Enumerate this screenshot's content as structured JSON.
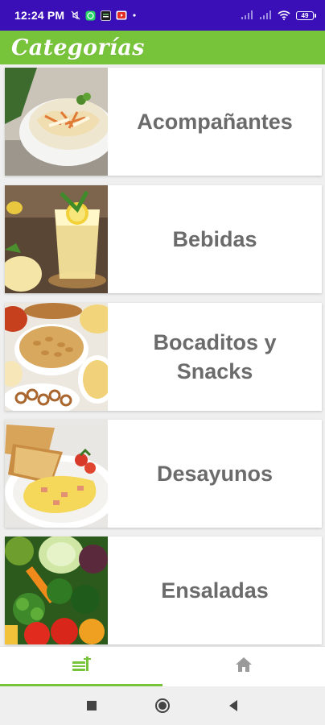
{
  "status_bar": {
    "time": "12:24 PM",
    "battery": "49",
    "icons": [
      "mute-icon",
      "whatsapp-icon",
      "notification-icon",
      "youtube-icon",
      "dot-icon",
      "signal-icon",
      "signal-icon",
      "wifi-icon",
      "battery-icon"
    ]
  },
  "app_bar": {
    "title": "Categorías"
  },
  "categories": [
    {
      "label": "Acompañantes",
      "image": "salad-bowl-photo"
    },
    {
      "label": "Bebidas",
      "image": "lemonade-drink-photo"
    },
    {
      "label": "Bocaditos y Snacks",
      "image": "snack-bowls-photo"
    },
    {
      "label": "Desayunos",
      "image": "breakfast-plate-photo"
    },
    {
      "label": "Ensaladas",
      "image": "vegetables-photo"
    }
  ],
  "bottom_nav": {
    "items": [
      {
        "icon": "restaurant-menu-icon",
        "active": true
      },
      {
        "icon": "home-icon",
        "active": false
      }
    ]
  },
  "colors": {
    "status_bar": "#3a0fb8",
    "app_bar": "#77c33a",
    "accent": "#77c33a",
    "label_text": "#6b6b6b"
  }
}
